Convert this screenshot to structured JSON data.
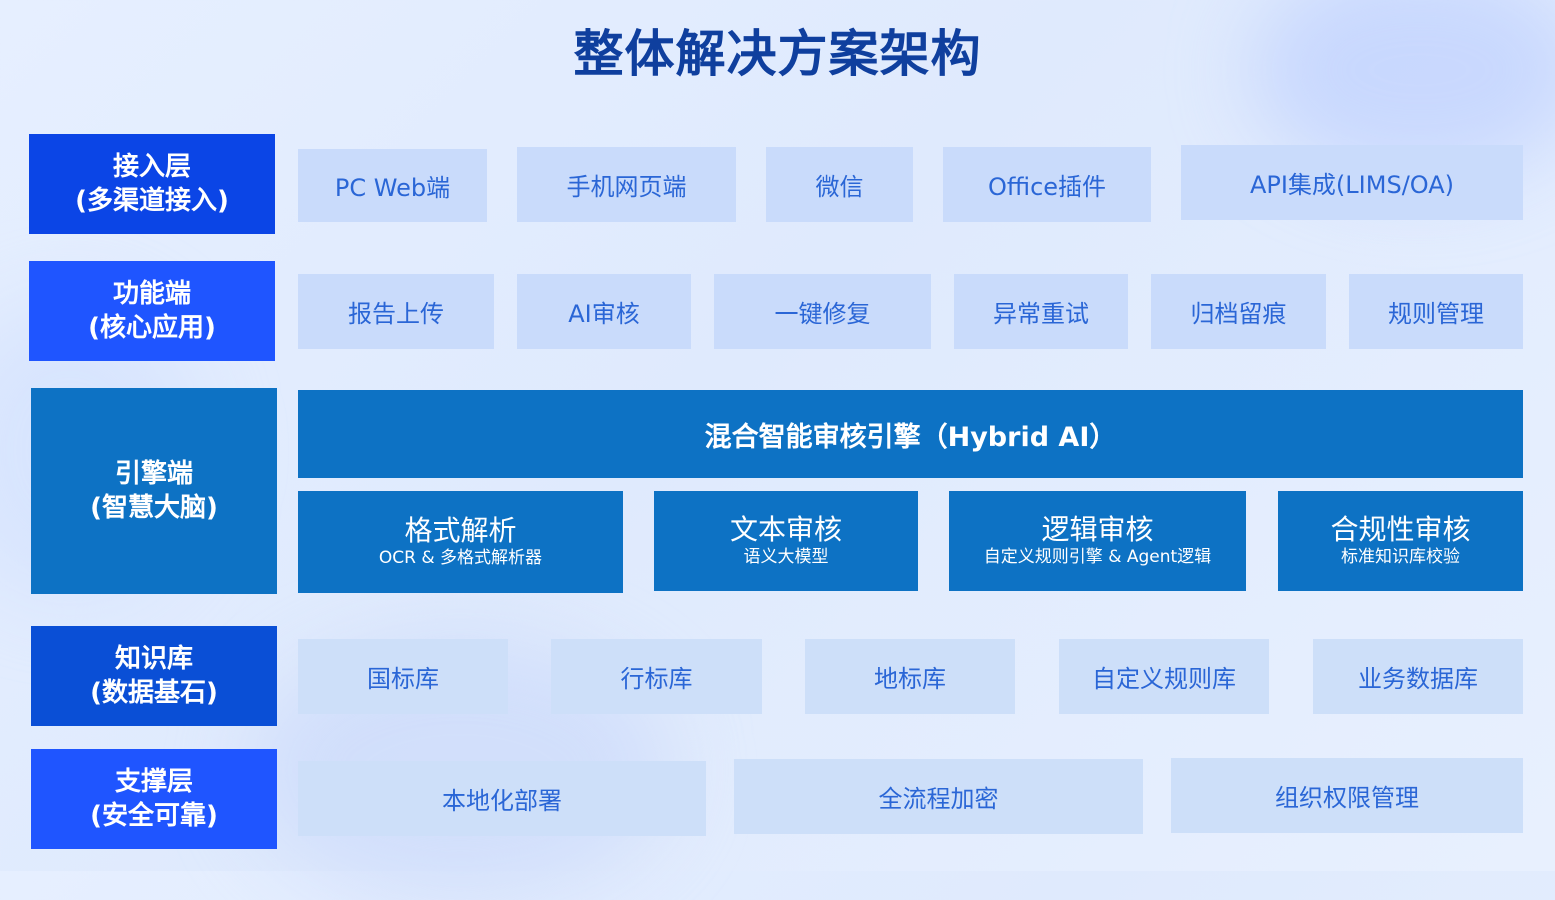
{
  "title": "整体解决方案架构",
  "colors": {
    "layer_dark": "#0b45e6",
    "layer_mid": "#1f55ff",
    "layer_engine": "#0d72c4",
    "layer_knowledge": "#0a4fd6",
    "cell_bg": "#c9dbfb",
    "cell_text": "#2a66d6",
    "title": "#0f3f9e"
  },
  "layers": {
    "access": {
      "name": "接入层",
      "sub": "(多渠道接入)"
    },
    "function": {
      "name": "功能端",
      "sub": "(核心应用)"
    },
    "engine": {
      "name": "引擎端",
      "sub": "(智慧大脑)"
    },
    "knowledge": {
      "name": "知识库",
      "sub": "(数据基石)"
    },
    "support": {
      "name": "支撑层",
      "sub": "(安全可靠)"
    }
  },
  "access_items": [
    "PC Web端",
    "手机网页端",
    "微信",
    "Office插件",
    "API集成(LIMS/OA)"
  ],
  "function_items": [
    "报告上传",
    "AI审核",
    "一键修复",
    "异常重试",
    "归档留痕",
    "规则管理"
  ],
  "engine": {
    "header": "混合智能审核引擎（Hybrid AI）",
    "modules": [
      {
        "name": "格式解析",
        "desc": "OCR & 多格式解析器"
      },
      {
        "name": "文本审核",
        "desc": "语义大模型"
      },
      {
        "name": "逻辑审核",
        "desc": "自定义规则引擎 & Agent逻辑"
      },
      {
        "name": "合规性审核",
        "desc": "标准知识库校验"
      }
    ]
  },
  "knowledge_items": [
    "国标库",
    "行标库",
    "地标库",
    "自定义规则库",
    "业务数据库"
  ],
  "support_items": [
    "本地化部署",
    "全流程加密",
    "组织权限管理"
  ]
}
